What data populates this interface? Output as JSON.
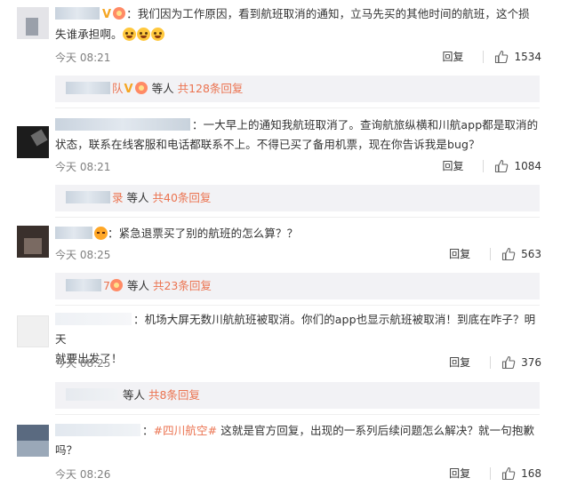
{
  "comments": [
    {
      "text": "：我们因为工作原因，看到航班取消的通知，立马先买的其他时间的航班，这个损失谁承担啊。",
      "line1": "：我们因为工作原因，看到航班取消的通知，立马先买的其他时间的航班，这个损",
      "line2": "失谁承担啊。",
      "name_visible": "",
      "time": "今天 08:21",
      "reply_label": "回复",
      "likes": "1534"
    },
    {
      "line1": "：一大早上的通知我航班取消了。查询航旅纵横和川航app都是取消的",
      "line2": "状态，联系在线客服和电话都联系不上。不得已买了备用机票，现在你告诉我是bug？",
      "time": "今天 08:21",
      "reply_label": "回复",
      "likes": "1084"
    },
    {
      "line1": "：紧急退票买了别的航班的怎么算？？",
      "time": "今天 08:25",
      "reply_label": "回复",
      "likes": "563"
    },
    {
      "line1": "：机场大屏无数川航航班被取消。你们的app也显示航班被取消！到底在咋子？明天",
      "line2": "就要出发了！",
      "time": "今天 08:25",
      "reply_label": "回复",
      "likes": "376"
    },
    {
      "topic": "#四川航空#",
      "line1_rest": " 这就是官方回复，出现的一系列后续问题怎么解决？就一句抱歉",
      "line2": "吗？",
      "time": "今天 08:26",
      "reply_label": "回复",
      "likes": "168"
    }
  ],
  "reply_summaries": [
    {
      "name_suffix": "队",
      "etc": "等人",
      "more": "共128条回复"
    },
    {
      "name_suffix": "录",
      "etc": "等人",
      "more": "共40条回复"
    },
    {
      "name_suffix": "7",
      "etc": "等人",
      "more": "共23条回复"
    },
    {
      "name_suffix": "",
      "etc": "等人",
      "more": "共8条回复"
    }
  ],
  "icons": {
    "like": "thumbs-up-icon",
    "verified": "v-badge-icon"
  },
  "colors": {
    "accent": "#eb7350",
    "meta": "#808080",
    "reply_bg": "#f2f2f5"
  }
}
